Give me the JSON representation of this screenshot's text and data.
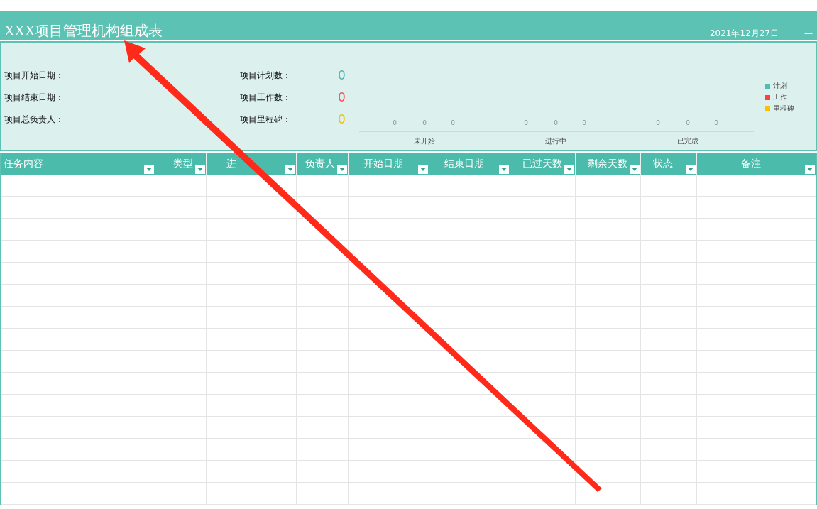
{
  "title_bar": {
    "title": "XXX项目管理机构组成表",
    "date": "2021年12月27日",
    "corner_mark": "—"
  },
  "summary": {
    "fields": [
      {
        "label": "项目开始日期："
      },
      {
        "label": "项目结束日期："
      },
      {
        "label": "项目总负责人："
      }
    ],
    "stats": [
      {
        "label": "项目计划数：",
        "value": "0",
        "color": "#4fb5ae"
      },
      {
        "label": "项目工作数：",
        "value": "0",
        "color": "#ff4b4b"
      },
      {
        "label": "项目里程碑：",
        "value": "0",
        "color": "#f5c000"
      }
    ],
    "chart": {
      "groups": [
        {
          "category": "未开始",
          "value_labels": [
            "0",
            "0",
            "0"
          ]
        },
        {
          "category": "进行中",
          "value_labels": [
            "0",
            "0",
            "0"
          ]
        },
        {
          "category": "已完成",
          "value_labels": [
            "0",
            "0",
            "0"
          ]
        }
      ],
      "legend": [
        {
          "name": "计划",
          "color": "#4fbdb0"
        },
        {
          "name": "工作",
          "color": "#ff4040"
        },
        {
          "name": "里程碑",
          "color": "#ffc000"
        }
      ]
    }
  },
  "table": {
    "columns": [
      {
        "label": "任务内容"
      },
      {
        "label": "类型"
      },
      {
        "label": "进"
      },
      {
        "label": "负责人"
      },
      {
        "label": "开始日期"
      },
      {
        "label": "结束日期"
      },
      {
        "label": "已过天数"
      },
      {
        "label": "剩余天数"
      },
      {
        "label": "状态"
      },
      {
        "label": "备注"
      }
    ]
  }
}
